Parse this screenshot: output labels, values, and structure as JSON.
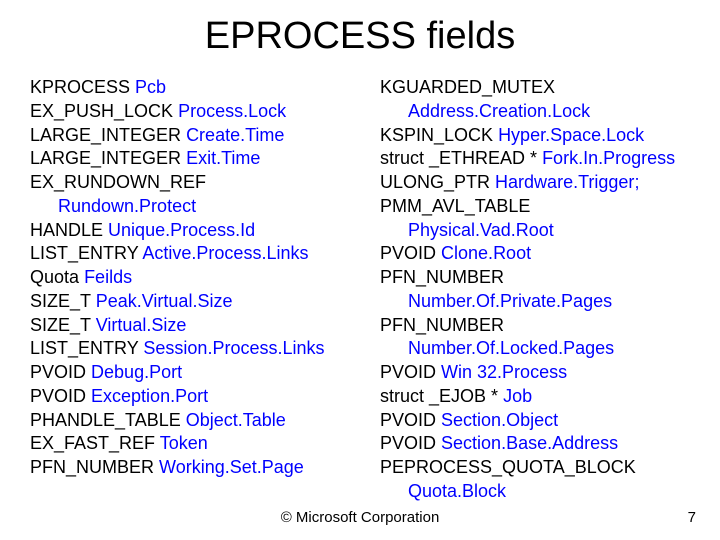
{
  "title": "EPROCESS fields",
  "left": [
    {
      "type": "KPROCESS",
      "member": "Pcb"
    },
    {
      "type": "EX_PUSH_LOCK",
      "member": "Process.Lock"
    },
    {
      "type": "LARGE_INTEGER",
      "member": "Create.Time"
    },
    {
      "type": "LARGE_INTEGER",
      "member": "Exit.Time"
    },
    {
      "type": "EX_RUNDOWN_REF",
      "member": "Rundown.Protect",
      "wrap": true
    },
    {
      "type": "HANDLE",
      "member": "Unique.Process.Id"
    },
    {
      "type": "LIST_ENTRY",
      "member": "Active.Process.Links"
    },
    {
      "type": "Quota",
      "member": "Feilds"
    },
    {
      "type": "SIZE_T",
      "member": "Peak.Virtual.Size"
    },
    {
      "type": "SIZE_T",
      "member": "Virtual.Size"
    },
    {
      "type": "LIST_ENTRY",
      "member": "Session.Process.Links"
    },
    {
      "type": "PVOID",
      "member": "Debug.Port"
    },
    {
      "type": "PVOID",
      "member": "Exception.Port"
    },
    {
      "type": "PHANDLE_TABLE",
      "member": "Object.Table"
    },
    {
      "type": "EX_FAST_REF",
      "member": "Token"
    },
    {
      "type": "PFN_NUMBER",
      "member": "Working.Set.Page"
    }
  ],
  "right": [
    {
      "type": "KGUARDED_MUTEX",
      "member": "Address.Creation.Lock",
      "wrap": true
    },
    {
      "type": "KSPIN_LOCK",
      "member": "Hyper.Space.Lock"
    },
    {
      "type": "struct _ETHREAD *",
      "member": "Fork.In.Progress"
    },
    {
      "type": "ULONG_PTR",
      "member": "Hardware.Trigger",
      "suffix": ";"
    },
    {
      "type": "PMM_AVL_TABLE",
      "member": "Physical.Vad.Root",
      "wrap": true
    },
    {
      "type": "PVOID",
      "member": "Clone.Root"
    },
    {
      "type": "PFN_NUMBER",
      "member": "Number.Of.Private.Pages",
      "wrap": true
    },
    {
      "type": "PFN_NUMBER",
      "member": "Number.Of.Locked.Pages",
      "wrap": true
    },
    {
      "type": "PVOID",
      "member": "Win 32.Process"
    },
    {
      "type": "struct _EJOB *",
      "member": "Job"
    },
    {
      "type": "PVOID",
      "member": "Section.Object"
    },
    {
      "type": "PVOID",
      "member": "Section.Base.Address"
    },
    {
      "type": "PEPROCESS_QUOTA_BLOCK",
      "member": "Quota.Block",
      "wrap": true
    }
  ],
  "footer": "© Microsoft Corporation",
  "pagenum": "7"
}
